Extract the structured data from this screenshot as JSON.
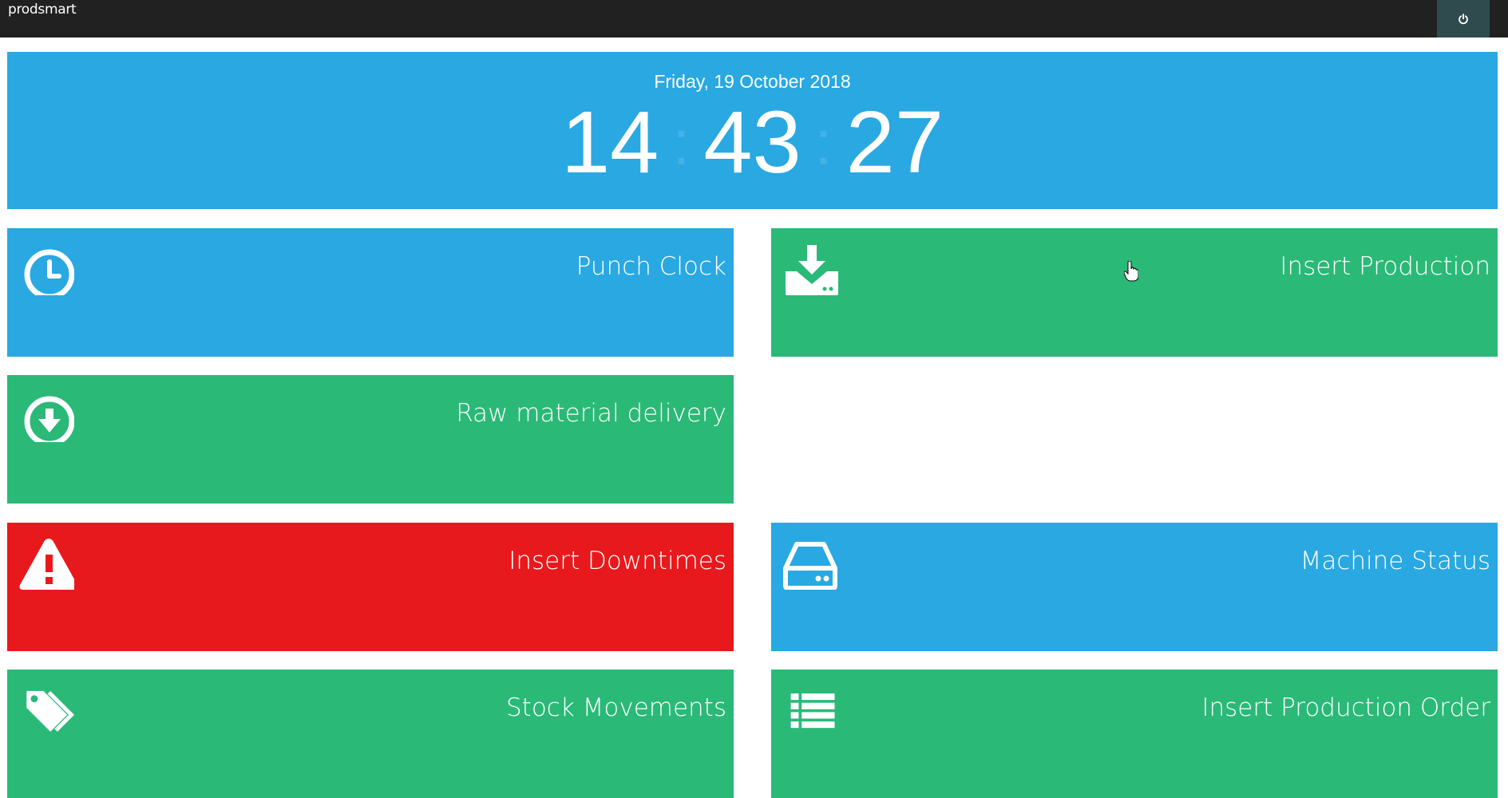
{
  "app": {
    "brand": "prodsmart",
    "power_icon": "power-icon"
  },
  "clock": {
    "date": "Friday, 19 October 2018",
    "hours": "14",
    "minutes": "43",
    "seconds": "27",
    "separator": ":"
  },
  "tiles": [
    {
      "label": "Punch Clock",
      "icon": "clock-icon",
      "color": "#29a8e2"
    },
    {
      "label": "Insert Production",
      "icon": "inbox-download-icon",
      "color": "#2ab977"
    },
    {
      "label": "Raw material delivery",
      "icon": "arrow-circle-down-icon",
      "color": "#2ab977"
    },
    {
      "label": "Insert Downtimes",
      "icon": "warning-icon",
      "color": "#e8191c"
    },
    {
      "label": "Machine Status",
      "icon": "hard-drive-icon",
      "color": "#29a8e2"
    },
    {
      "label": "Stock Movements",
      "icon": "tags-icon",
      "color": "#2ab977"
    },
    {
      "label": "Insert Production Order",
      "icon": "list-icon",
      "color": "#2ab977"
    }
  ]
}
